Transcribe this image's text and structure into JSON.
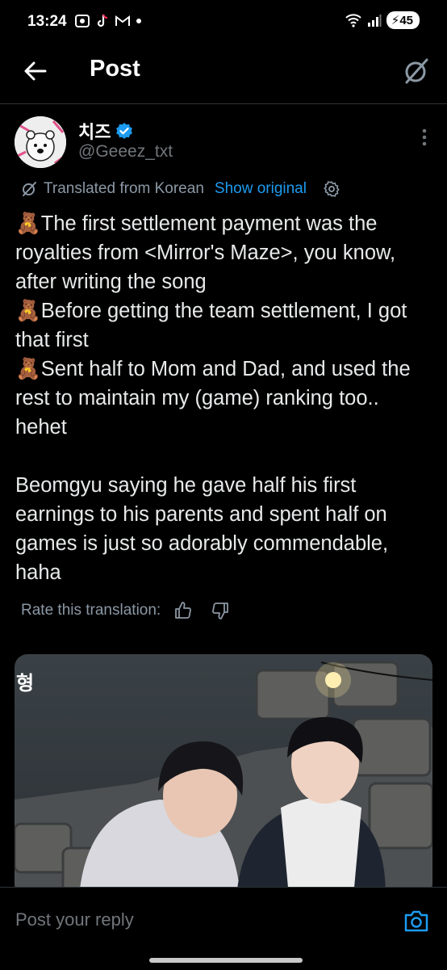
{
  "status_bar": {
    "time": "13:24",
    "battery": "45",
    "left_icons": [
      "screen-record-icon",
      "tiktok-icon",
      "gmail-icon",
      "dot-icon"
    ],
    "right_icons": [
      "wifi-icon",
      "signal-icon",
      "battery-icon"
    ]
  },
  "header": {
    "title": "Post",
    "back_icon": "arrow-left-icon",
    "grok_icon": "grok-icon"
  },
  "author": {
    "name": "치즈",
    "handle": "@Geeez_txt",
    "verified": true
  },
  "translation": {
    "translated_label": "Translated from Korean",
    "show_original": "Show original"
  },
  "tweet": {
    "paragraphs": [
      "🧸The first settlement payment was the royalties from <Mirror's Maze>, you know, after writing the song\n🧸Before getting the team settlement, I got that first\n🧸Sent half to Mom and Dad, and used the rest to maintain my (game) ranking too.. hehet",
      "Beomgyu saying he gave half his first earnings to his parents and spent half on games is just so adorably commendable, haha"
    ]
  },
  "rate": {
    "label": "Rate this translation:"
  },
  "media": {
    "caption_char": "형"
  },
  "reply": {
    "placeholder": "Post your reply"
  },
  "colors": {
    "accent": "#1d9bf0",
    "background": "#000000",
    "text": "#e7e9ea",
    "muted": "#71767b"
  }
}
